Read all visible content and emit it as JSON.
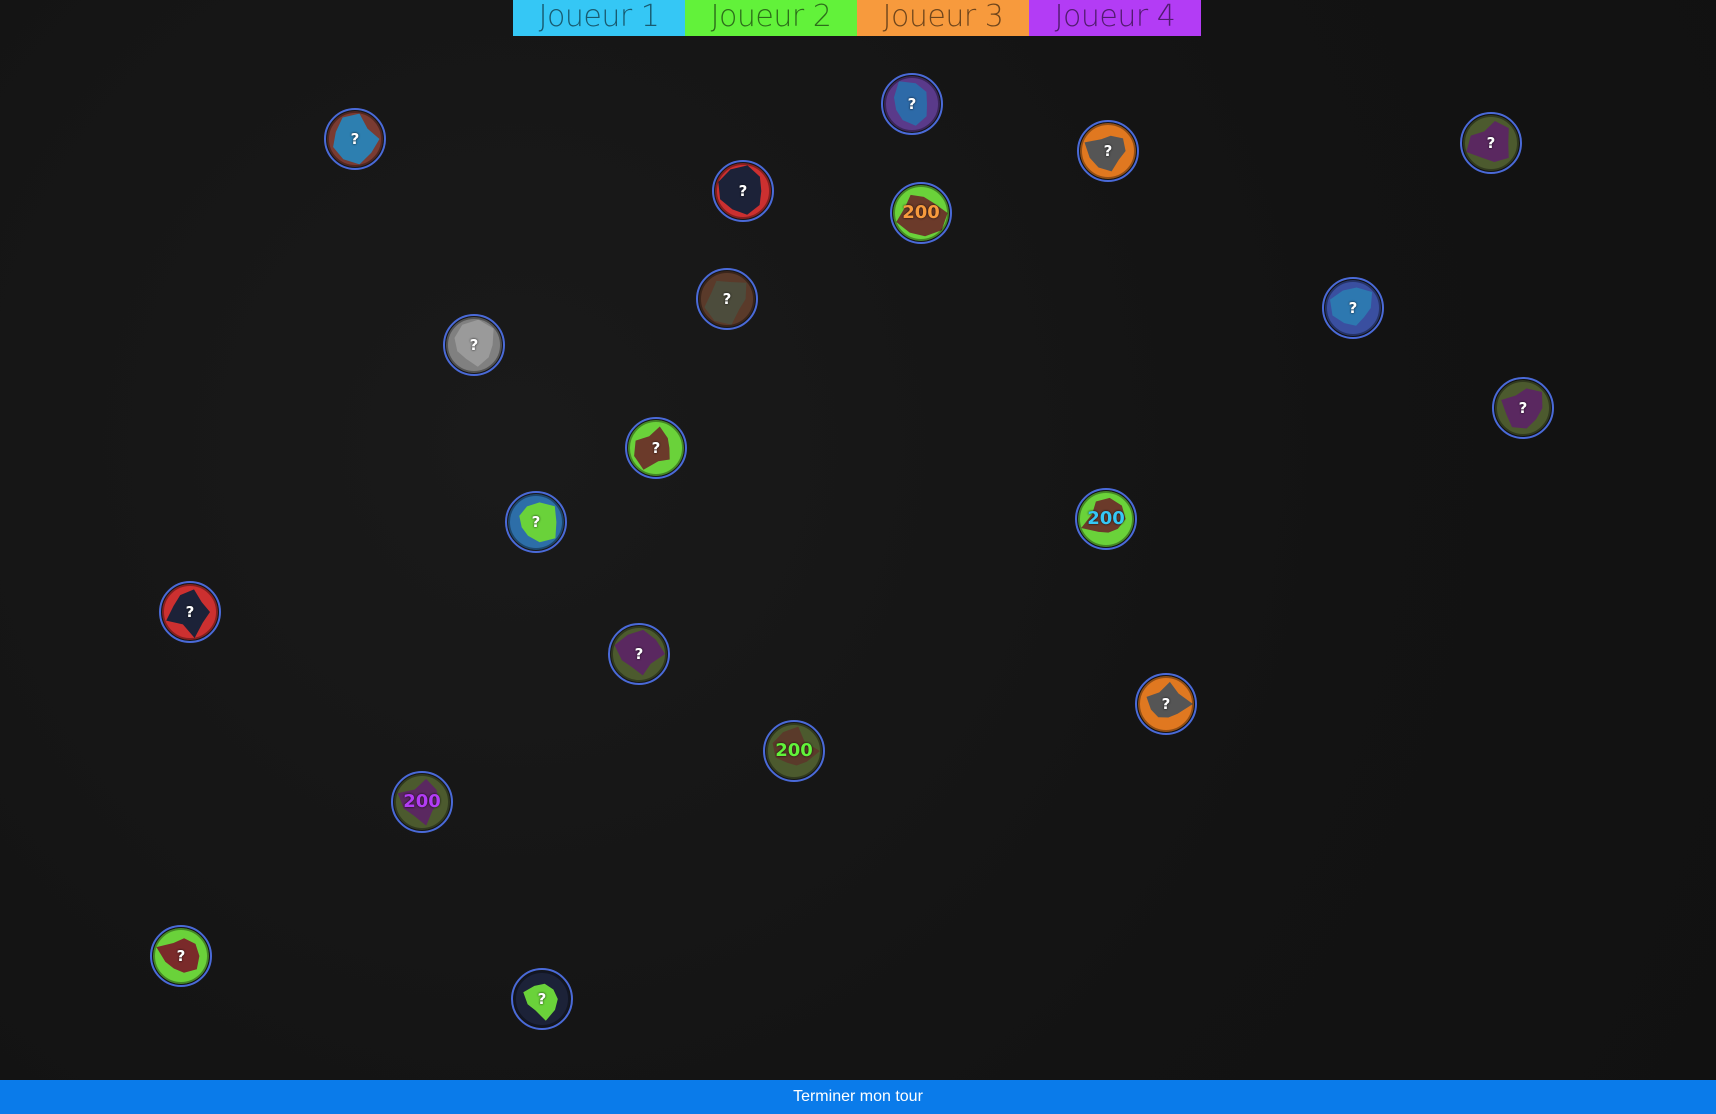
{
  "players": [
    {
      "label": "Joueur 1",
      "color": "#35c7f5",
      "active": true
    },
    {
      "label": "Joueur 2",
      "color": "#62f23a",
      "active": false
    },
    {
      "label": "Joueur 3",
      "color": "#f79a3d",
      "active": false
    },
    {
      "label": "Joueur 4",
      "color": "#b33cf5",
      "active": false
    }
  ],
  "planets": [
    {
      "label": "?",
      "base": "#7a3b32",
      "spot": "#2d7fb0",
      "owner": null
    },
    {
      "label": "?",
      "base": "#5a3a8a",
      "spot": "#2d6aa8",
      "owner": null
    },
    {
      "label": "?",
      "base": "#cc3030",
      "spot": "#1c2238",
      "owner": null
    },
    {
      "label": "200",
      "base": "#6ad23a",
      "spot": "#6b3a2a",
      "owner": "player3",
      "labelColor": "#f79a3d"
    },
    {
      "label": "?",
      "base": "#e07820",
      "spot": "#555555",
      "owner": null
    },
    {
      "label": "?",
      "base": "#4c5a2e",
      "spot": "#5a2860",
      "owner": null
    },
    {
      "label": "?",
      "base": "#5a3a2a",
      "spot": "#4c4c3c",
      "owner": null
    },
    {
      "label": "?",
      "base": "#808080",
      "spot": "#9a9a9a",
      "owner": null
    },
    {
      "label": "?",
      "base": "#3a4fa0",
      "spot": "#2d78b0",
      "owner": null
    },
    {
      "label": "?",
      "base": "#4c5a2e",
      "spot": "#5a2860",
      "owner": null
    },
    {
      "label": "?",
      "base": "#6ad23a",
      "spot": "#6b3a2a",
      "owner": null
    },
    {
      "label": "?",
      "base": "#2d6ea8",
      "spot": "#6ad23a",
      "owner": null
    },
    {
      "label": "200",
      "base": "#6ad23a",
      "spot": "#6b3a2a",
      "owner": "player1",
      "labelColor": "#35c7f5"
    },
    {
      "label": "?",
      "base": "#cc3030",
      "spot": "#1c2238",
      "owner": null
    },
    {
      "label": "?",
      "base": "#4c5a2e",
      "spot": "#5a2860",
      "owner": null
    },
    {
      "label": "?",
      "base": "#e07820",
      "spot": "#555555",
      "owner": null
    },
    {
      "label": "200",
      "base": "#4c5a2e",
      "spot": "#5a3a2a",
      "owner": "player2",
      "labelColor": "#62f23a"
    },
    {
      "label": "200",
      "base": "#4c5a2e",
      "spot": "#5a2860",
      "owner": "player4",
      "labelColor": "#b33cf5"
    },
    {
      "label": "?",
      "base": "#6ad23a",
      "spot": "#7a2a2a",
      "owner": null
    },
    {
      "label": "?",
      "base": "#1c2238",
      "spot": "#6ad23a",
      "owner": null
    }
  ],
  "end_turn_label": "Terminer mon tour"
}
